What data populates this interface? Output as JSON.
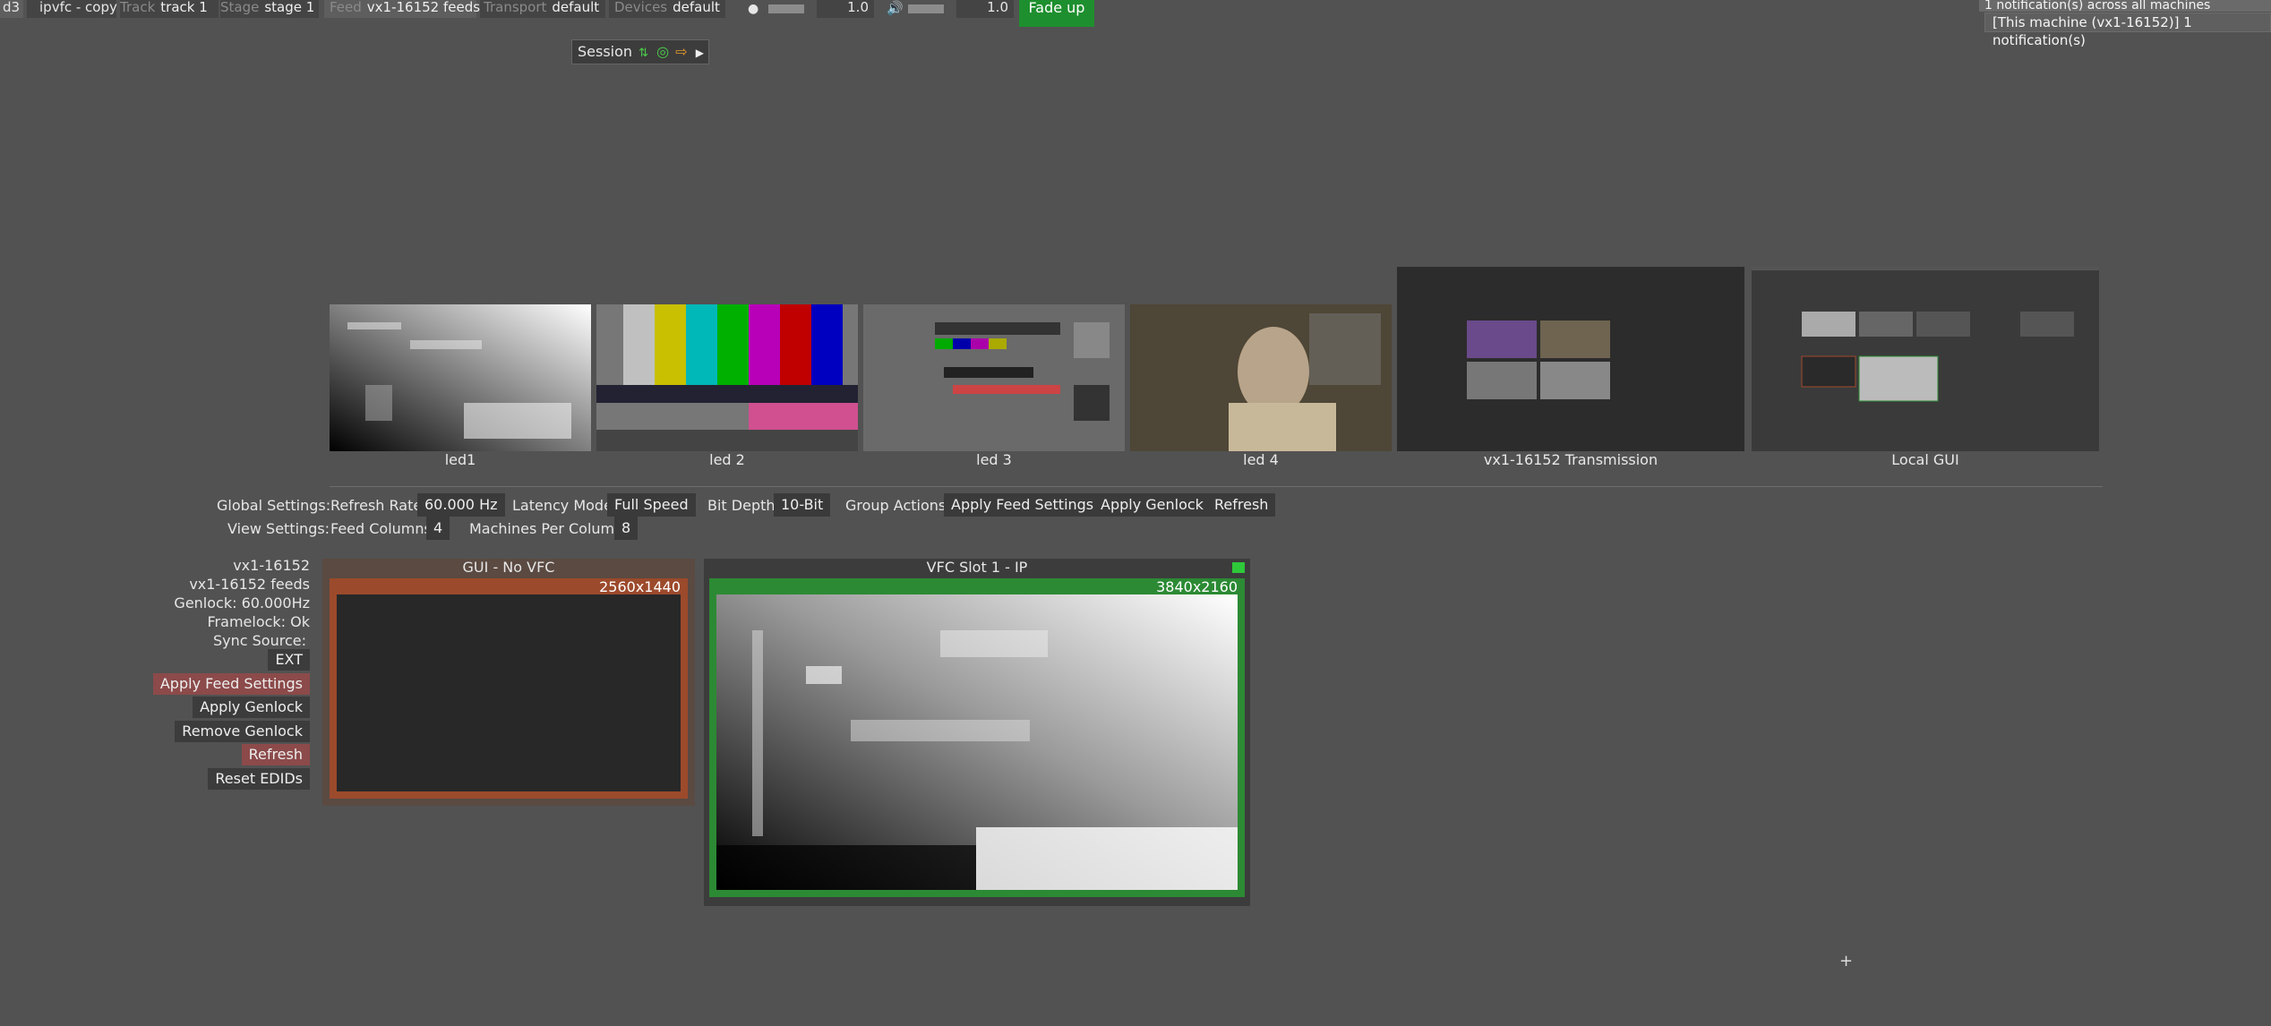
{
  "topbar": {
    "app": "d3",
    "project": "ipvfc - copy",
    "track_label": "Track",
    "track_value": "track 1",
    "stage_label": "Stage",
    "stage_value": "stage 1",
    "feed_label": "Feed",
    "feed_value": "vx1-16152 feeds",
    "transport_label": "Transport",
    "transport_value": "default",
    "devices_label": "Devices",
    "devices_value": "default",
    "brightness_value": "1.0",
    "volume_value": "1.0",
    "fade_button": "Fade up"
  },
  "notifications": {
    "summary": "1 notification(s) across all machines",
    "machine": "[This machine (vx1-16152)] 1 notification(s)"
  },
  "session": {
    "label": "Session",
    "icons": [
      "network-icon",
      "target-icon",
      "exit-icon",
      "play-icon"
    ]
  },
  "feeds": [
    {
      "label": "led1"
    },
    {
      "label": "led 2"
    },
    {
      "label": "led 3"
    },
    {
      "label": "led 4"
    },
    {
      "label": "vx1-16152 Transmission"
    },
    {
      "label": "Local GUI"
    }
  ],
  "global_settings": {
    "label": "Global Settings:",
    "refresh_rate_label": "Refresh Rate",
    "refresh_rate_value": "60.000 Hz",
    "latency_label": "Latency Mode",
    "latency_value": "Full Speed",
    "bit_depth_label": "Bit Depth",
    "bit_depth_value": "10-Bit",
    "group_actions_label": "Group Actions:",
    "apply_feed_settings": "Apply Feed Settings",
    "apply_genlock": "Apply Genlock",
    "refresh": "Refresh"
  },
  "view_settings": {
    "label": "View Settings:",
    "feed_columns_label": "Feed Columns",
    "feed_columns_value": "4",
    "machines_per_column_label": "Machines Per Column",
    "machines_per_column_value": "8"
  },
  "machine": {
    "name": "vx1-16152",
    "feeds": "vx1-16152 feeds",
    "genlock": "Genlock: 60.000Hz",
    "framelock": "Framelock: Ok",
    "sync_source": "Sync Source:",
    "sync_value": "EXT",
    "apply_feed_settings": "Apply Feed Settings",
    "apply_genlock": "Apply Genlock",
    "remove_genlock": "Remove Genlock",
    "refresh": "Refresh",
    "reset_edids": "Reset EDIDs"
  },
  "outputs": [
    {
      "title": "GUI - No VFC",
      "resolution": "2560x1440",
      "color": "#9c4a2c"
    },
    {
      "title": "VFC Slot 1 - IP",
      "resolution": "3840x2160",
      "color": "#2c8a34"
    }
  ],
  "colors": {
    "background": "#525252",
    "fade": "#1e8f2e",
    "red_button": "#8c4a4a"
  }
}
